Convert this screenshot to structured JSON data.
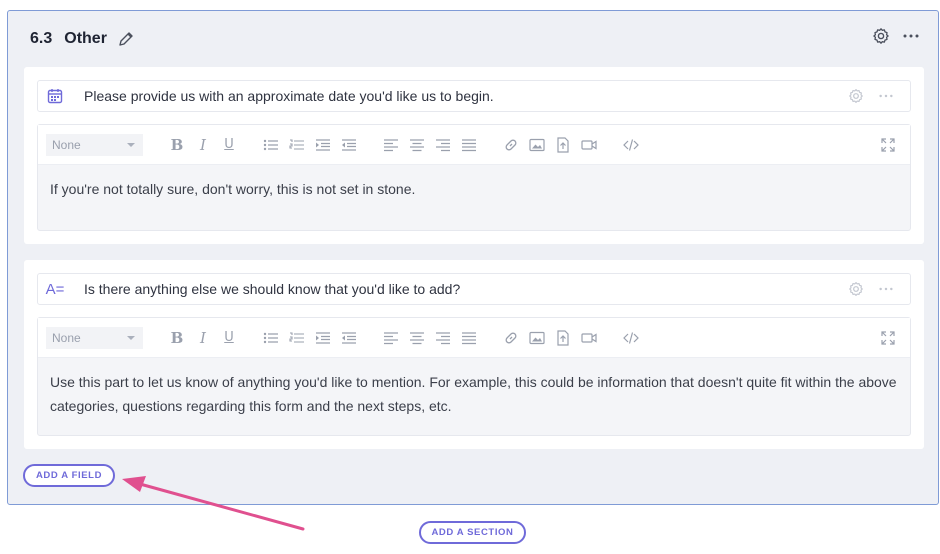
{
  "section": {
    "number": "6.3",
    "title": "Other",
    "icons": {
      "edit": "pencil-icon",
      "settings": "gear-icon",
      "more": "more-horizontal-icon"
    }
  },
  "fields": [
    {
      "type_icon": "calendar-icon",
      "question": "Please provide us with an approximate date you'd like us to begin.",
      "format_select": "None",
      "content": "If you're not totally sure, don't worry, this is not set in stone."
    },
    {
      "type_icon_text": "A=",
      "question": "Is there anything else we should know that you'd like to add?",
      "format_select": "None",
      "content": "Use this part to let us know of anything you'd like to mention. For example, this could be information that doesn't quite fit within the above categories, questions regarding this form and the next steps, etc."
    }
  ],
  "buttons": {
    "add_field": "ADD A FIELD",
    "add_section": "ADD A SECTION"
  },
  "colors": {
    "accent": "#6f6ad9",
    "section_border": "#7f9bd6",
    "annotation_arrow": "#e0508f"
  }
}
